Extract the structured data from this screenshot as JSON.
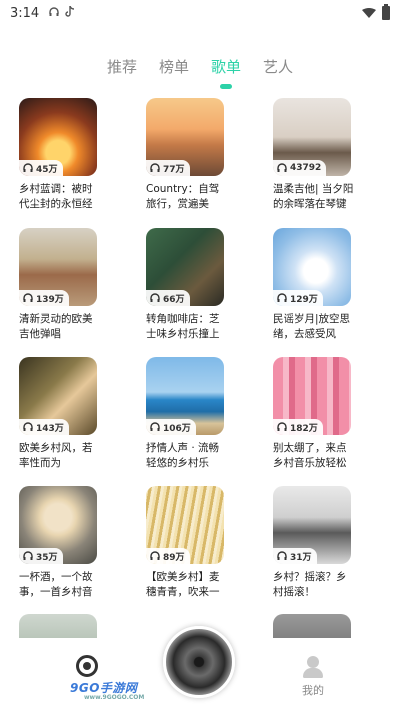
{
  "status_bar": {
    "time": "3:14",
    "icons": [
      "headphones-icon",
      "tiktok-icon"
    ]
  },
  "tabs": [
    {
      "label": "推荐",
      "active": false
    },
    {
      "label": "榜单",
      "active": false
    },
    {
      "label": "歌单",
      "active": true
    },
    {
      "label": "艺人",
      "active": false
    }
  ],
  "playlists": [
    {
      "count": "45万",
      "title": "乡村蓝调：被时代尘封的永恒经典"
    },
    {
      "count": "77万",
      "title": "Country：自驾旅行，赏遍美景，..."
    },
    {
      "count": "43792",
      "title": "温柔吉他| 当夕阳的余晖落在琴键上"
    },
    {
      "count": "139万",
      "title": "清新灵动的欧美吉他弹唱"
    },
    {
      "count": "66万",
      "title": "转角咖啡店：芝士味乡村乐撞上柠..."
    },
    {
      "count": "129万",
      "title": "民谣岁月|放空思绪，去感受风"
    },
    {
      "count": "143万",
      "title": "欧美乡村风，若率性而为"
    },
    {
      "count": "106万",
      "title": "抒情人声 · 流畅轻悠的乡村乐"
    },
    {
      "count": "182万",
      "title": "别太绷了，来点乡村音乐放轻松"
    },
    {
      "count": "35万",
      "title": "一杯酒，一个故事，一首乡村音乐"
    },
    {
      "count": "89万",
      "title": "【欧美乡村】麦穗青青，吹来一阵..."
    },
    {
      "count": "31万",
      "title": "乡村？摇滚？乡村摇滚！"
    }
  ],
  "bottom_nav": {
    "me_label": "我的"
  },
  "watermark": {
    "text": "9GO手游网",
    "sub": "www.9GOGO.COM"
  },
  "colors": {
    "accent": "#2dd2a8"
  }
}
